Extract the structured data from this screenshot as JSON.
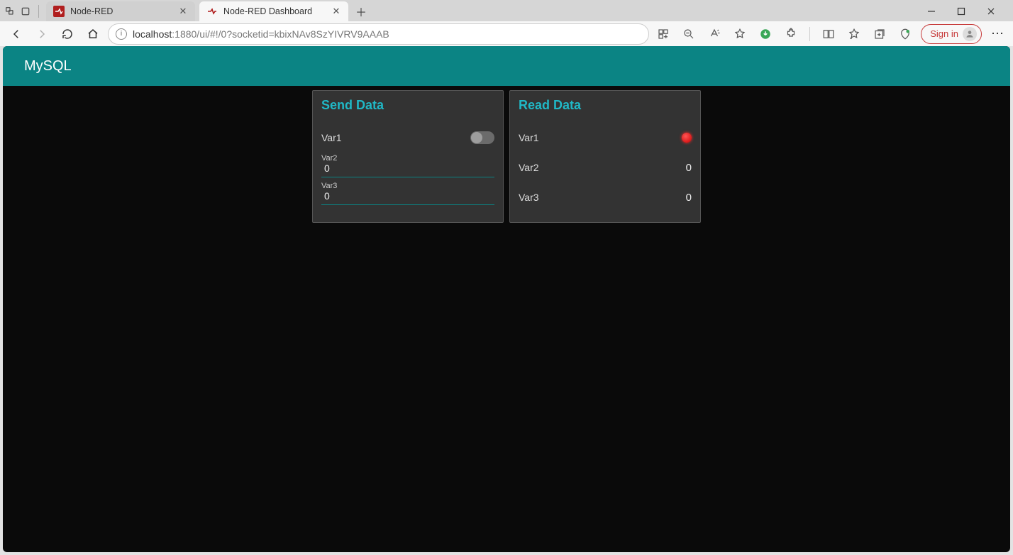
{
  "browser": {
    "tabs": [
      {
        "title": "Node-RED",
        "active": false
      },
      {
        "title": "Node-RED Dashboard",
        "active": true
      }
    ],
    "url_host": "localhost",
    "url_port_path": ":1880/ui/#!/0?socketid=kbixNAv8SzYIVRV9AAAB",
    "signin_label": "Sign in"
  },
  "app": {
    "header_title": "MySQL",
    "send_card": {
      "title": "Send Data",
      "var1_label": "Var1",
      "var1_switch_on": false,
      "var2_label": "Var2",
      "var2_value": "0",
      "var3_label": "Var3",
      "var3_value": "0"
    },
    "read_card": {
      "title": "Read Data",
      "var1_label": "Var1",
      "var1_led_color": "#e60000",
      "var2_label": "Var2",
      "var2_value": "0",
      "var3_label": "Var3",
      "var3_value": "0"
    }
  }
}
